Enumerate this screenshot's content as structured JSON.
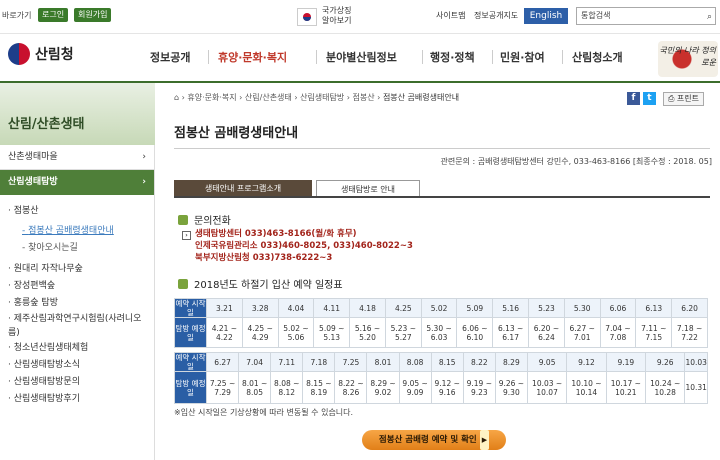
{
  "topbar": {
    "shortcut": "바로가기",
    "login": "로그인",
    "join": "회원가입",
    "symbol_text": "국가상징 알아보기",
    "sitemap": "사이트맵",
    "info_map": "정보공개지도",
    "english": "English",
    "search_placeholder": "통합검색"
  },
  "gnb": {
    "logo": "산림청",
    "menus": [
      "정보공개",
      "휴양·문화·복지",
      "분야별산림정보",
      "행정·정책",
      "민원·참여",
      "산림청소개"
    ],
    "brand": "국민의 나라 정의로운"
  },
  "lnb": {
    "title": "산림/산촌생태",
    "items": [
      {
        "label": "산촌생태마을",
        "arrow": "›"
      },
      {
        "label": "산림생태탐방",
        "arrow": "›"
      }
    ],
    "subs": [
      "점봉산",
      "점봉산 곰배령생태안내",
      "찾아오시는길",
      "원대리 자작나무숲",
      "장성편백숲",
      "홍릉숲 탐방",
      "제주산림과학연구시험림(사려니오름)",
      "청소년산림생태체험",
      "산림생태탐방소식",
      "산림생태탐방문의",
      "산림생태탐방후기"
    ]
  },
  "content": {
    "breadcrumb": [
      "휴양·문화·복지",
      "산림/산촌생태",
      "산림생태탐방",
      "점봉산"
    ],
    "current": "점봉산 곰배령생태안내",
    "print": "프린트",
    "fb": "f",
    "tw": "t",
    "title": "점봉산 곰배령생태안내",
    "inquiry": "관련문의 : 곰배령생태탐방센터 강민수, 033-463-8166 [최종수정 : 2018. 05]",
    "tab1": "생태안내 프로그램소개",
    "tab2": "생태탐방로 안내",
    "sec1": "문의전화",
    "phones": [
      "생태탐방센터 033)463-8166(월/화 휴무)",
      "인제국유림관리소 033)460-8025, 033)460-8022~3",
      "북부지방산림청 033)738-6222~3"
    ],
    "sec2": "2018년도 하절기 입산 예약 일정표",
    "row_start": "예약 시작일",
    "row_date": "탐방 예정일",
    "t1_start": [
      "3.21",
      "3.28",
      "4.04",
      "4.11",
      "4.18",
      "4.25",
      "5.02",
      "5.09",
      "5.16",
      "5.23",
      "5.30",
      "6.06",
      "6.13",
      "6.20"
    ],
    "t1_dates": [
      "4.21 ~ 4.22",
      "4.25 ~ 4.29",
      "5.02 ~ 5.06",
      "5.09 ~ 5.13",
      "5.16 ~ 5.20",
      "5.23 ~ 5.27",
      "5.30 ~ 6.03",
      "6.06 ~ 6.10",
      "6.13 ~ 6.17",
      "6.20 ~ 6.24",
      "6.27 ~ 7.01",
      "7.04 ~ 7.08",
      "7.11 ~ 7.15",
      "7.18 ~ 7.22"
    ],
    "t2_start": [
      "6.27",
      "7.04",
      "7.11",
      "7.18",
      "7.25",
      "8.01",
      "8.08",
      "8.15",
      "8.22",
      "8.29",
      "9.05",
      "9.12",
      "9.19",
      "9.26",
      "10.03"
    ],
    "t2_dates": [
      "7.25 ~ 7.29",
      "8.01 ~ 8.05",
      "8.08 ~ 8.12",
      "8.15 ~ 8.19",
      "8.22 ~ 8.26",
      "8.29 ~ 9.02",
      "9.05 ~ 9.09",
      "9.12 ~ 9.16",
      "9.19 ~ 9.23",
      "9.26 ~ 9.30",
      "10.03 ~ 10.07",
      "10.10 ~ 10.14",
      "10.17 ~ 10.21",
      "10.24 ~ 10.28",
      "10.31"
    ],
    "note": "※입산 시작일은 기상상황에 따라 변동될 수 있습니다.",
    "cta": "점봉산 곰배령 예약 및 확인"
  },
  "colors": {
    "green": "#4f7f39",
    "blue": "#2a5ea5",
    "orange": "#e8891c"
  }
}
